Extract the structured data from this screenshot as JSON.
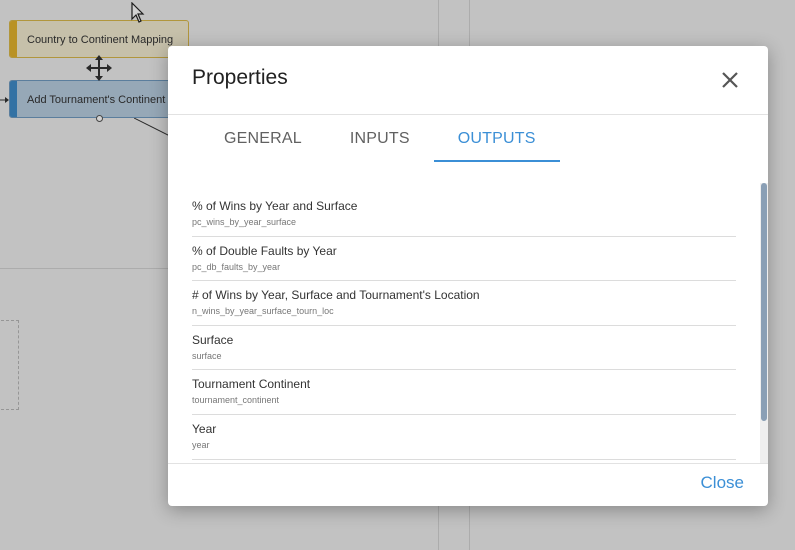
{
  "canvas": {
    "nodes": [
      {
        "label": "Country to Continent Mapping"
      },
      {
        "label": "Add Tournament's Continent"
      }
    ]
  },
  "modal": {
    "title": "Properties",
    "tabs": [
      {
        "label": "GENERAL",
        "active": false
      },
      {
        "label": "INPUTS",
        "active": false
      },
      {
        "label": "OUTPUTS",
        "active": true
      }
    ],
    "outputs": [
      {
        "label": "% of Wins by Year and Surface",
        "key": "pc_wins_by_year_surface"
      },
      {
        "label": "% of Double Faults by Year",
        "key": "pc_db_faults_by_year"
      },
      {
        "label": "# of Wins by Year, Surface and Tournament's Location",
        "key": "n_wins_by_year_surface_tourn_loc"
      },
      {
        "label": "Surface",
        "key": "surface"
      },
      {
        "label": "Tournament Continent",
        "key": "tournament_continent"
      },
      {
        "label": "Year",
        "key": "year"
      }
    ],
    "close_label": "Close"
  },
  "colors": {
    "accent": "#3b8fd6",
    "map_node": "#e2b22c",
    "add_node": "#3f8bc9"
  },
  "icons": {
    "close": "close-icon",
    "move": "move-icon",
    "pointer": "mouse-pointer-icon"
  }
}
